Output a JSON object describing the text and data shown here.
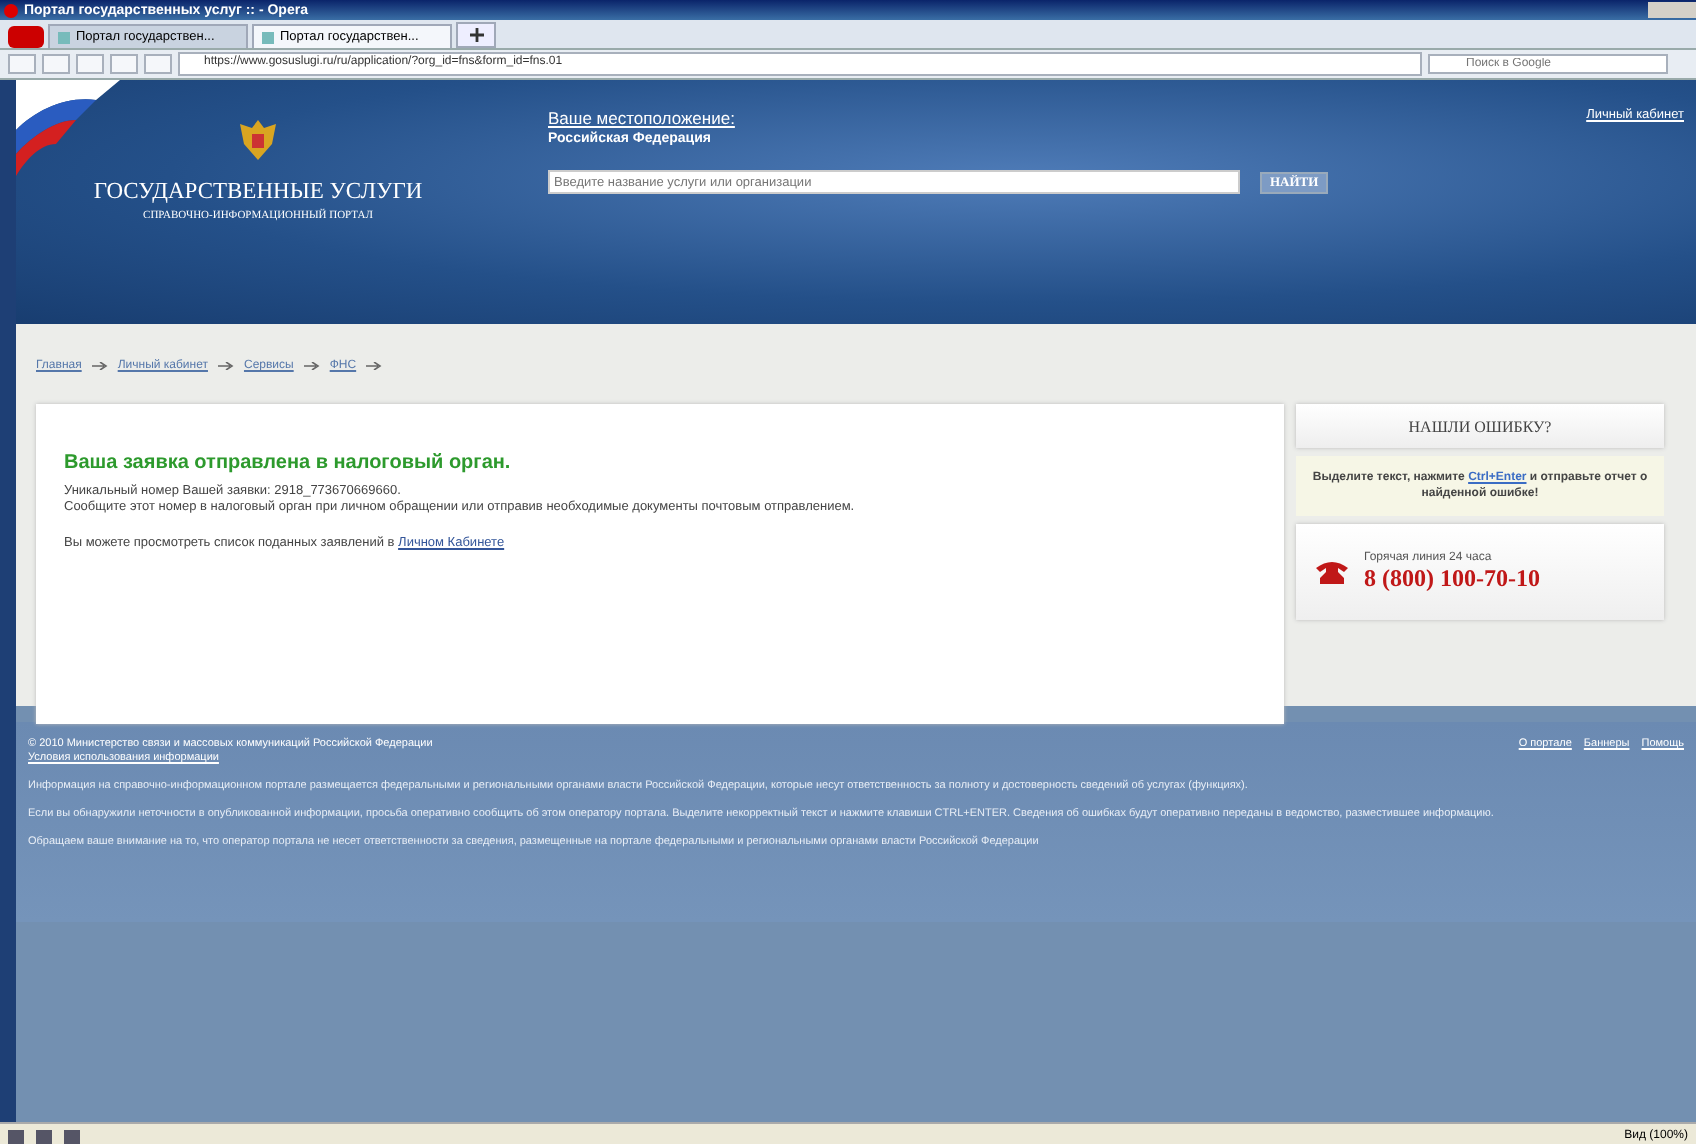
{
  "window": {
    "title": "Портал государственных услуг :: - Opera"
  },
  "tabs": [
    {
      "label": "Портал государствен...",
      "selected": false
    },
    {
      "label": "Портал государствен...",
      "selected": true
    }
  ],
  "address_bar": {
    "url": "https://www.gosuslugi.ru/ru/application/?org_id=fns&form_id=fns.01"
  },
  "browser_search": {
    "placeholder": "Поиск в Google"
  },
  "header": {
    "logo_title": "ГОСУДАРСТВЕННЫЕ УСЛУГИ",
    "logo_subtitle": "СПРАВОЧНО-ИНФОРМАЦИОННЫЙ ПОРТАЛ",
    "location_label": "Ваше местоположение:",
    "location": "Российская Федерация",
    "search_placeholder": "Введите название услуги или организации",
    "search_button": "НАЙТИ",
    "account_link": "Личный кабинет"
  },
  "breadcrumbs": [
    {
      "label": "Главная"
    },
    {
      "label": "Личный кабинет"
    },
    {
      "label": "Сервисы"
    },
    {
      "label": "ФНС"
    }
  ],
  "message": {
    "title": "Ваша заявка отправлена в налоговый орган.",
    "number_line": "Уникальный номер Вашей заявки: 2918_773670669660.",
    "instruction": "Сообщите этот номер в налоговый орган при личном обращении или отправив необходимые документы почтовым отправлением.",
    "list_text": "Вы можете просмотреть список поданных заявлений в",
    "list_link": "Личном Кабинете"
  },
  "error_panel": {
    "title": "НАШЛИ ОШИБКУ?",
    "text_before": "Выделите текст, нажмите",
    "shortcut": "Ctrl+Enter",
    "text_after": "и отправьте отчет о найденной ошибке!"
  },
  "hotline": {
    "label": "Горячая линия 24 часа",
    "phone": "8 (800) 100-70-10"
  },
  "footer": {
    "copyright": "© 2010 Министерство связи и массовых коммуникаций Российской Федерации",
    "terms_link": "Условия использования информации",
    "links": [
      "О портале",
      "Баннеры",
      "Помощь"
    ],
    "notes": [
      "Информация на справочно-информационном портале размещается федеральными и региональными органами власти Российской Федерации, которые несут ответственность за полноту и достоверность сведений об услугах (функциях).",
      "Если вы обнаружили неточности в опубликованной информации, просьба оперативно сообщить об этом оператору портала. Выделите некорректный текст и нажмите клавиши CTRL+ENTER. Сведения об ошибках будут оперативно переданы в ведомство, разместившее информацию.",
      "Обращаем ваше внимание на то, что оператор портала не несет ответственности за сведения, размещенные на портале федеральными и региональными органами власти Российской Федерации"
    ]
  },
  "status_bar": {
    "zoom": "Вид (100%)"
  }
}
